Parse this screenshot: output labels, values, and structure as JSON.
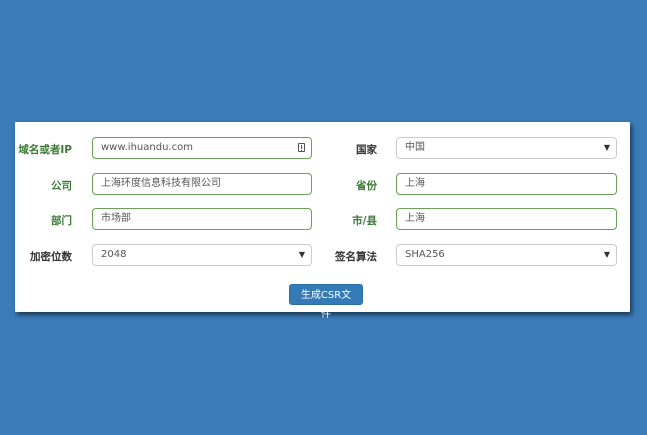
{
  "form": {
    "domain": {
      "label": "域名或者IP",
      "value": "www.ihuandu.com"
    },
    "country": {
      "label": "国家",
      "value": "中国"
    },
    "company": {
      "label": "公司",
      "value": "上海环度信息科技有限公司"
    },
    "province": {
      "label": "省份",
      "value": "上海"
    },
    "department": {
      "label": "部门",
      "value": "市场部"
    },
    "city": {
      "label": "市/县",
      "value": "上海"
    },
    "key_bits": {
      "label": "加密位数",
      "value": "2048"
    },
    "algorithm": {
      "label": "签名算法",
      "value": "SHA256"
    },
    "submit_label": "生成CSR文件"
  },
  "colors": {
    "background": "#3a7bb8",
    "valid_label": "#3c7a36",
    "button": "#337ab7"
  },
  "icons": {
    "dropdown": "caret-down-icon",
    "field_hint": "warning-icon"
  }
}
